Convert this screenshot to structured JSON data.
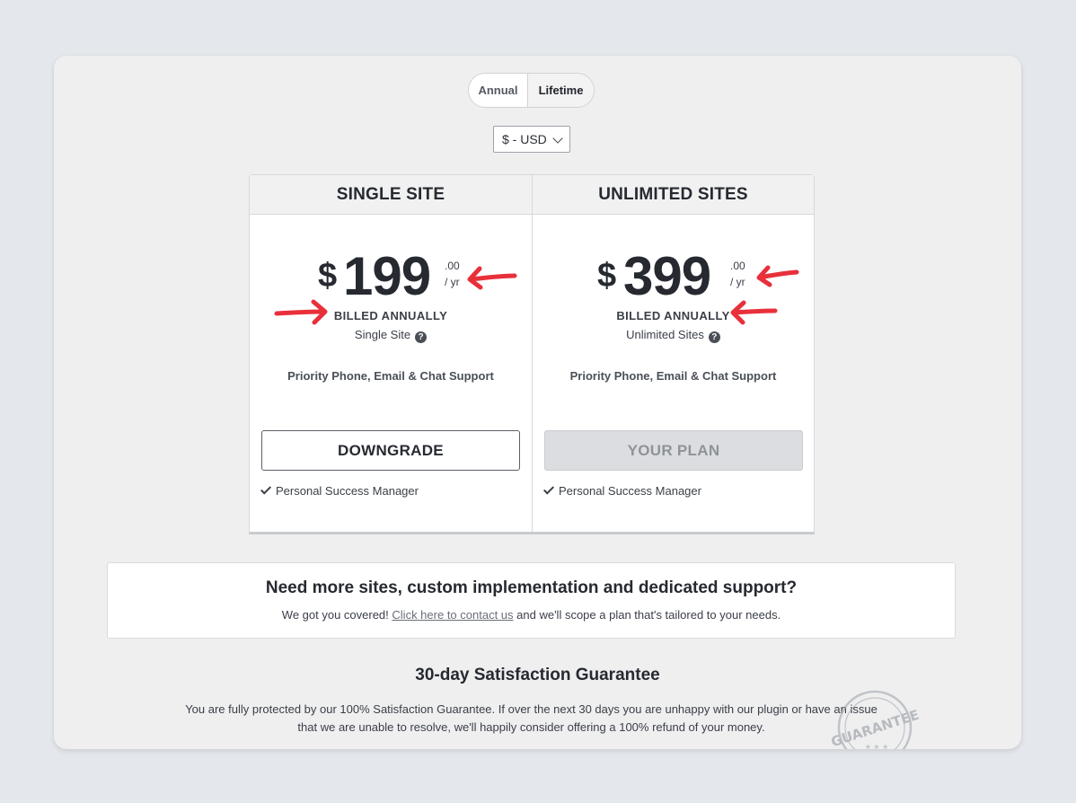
{
  "billing_toggle": {
    "options": [
      "Annual",
      "Lifetime"
    ],
    "selected": "Lifetime"
  },
  "currency": {
    "selected": "$ - USD"
  },
  "plans": [
    {
      "title": "SINGLE SITE",
      "currency_symbol": "$",
      "price": "199",
      "cents": ".00",
      "period": "/ yr",
      "billing": "BILLED ANNUALLY",
      "sites": "Single Site",
      "support": "Priority Phone, Email & Chat Support",
      "button_label": "DOWNGRADE",
      "feature": "Personal Success Manager"
    },
    {
      "title": "UNLIMITED SITES",
      "currency_symbol": "$",
      "price": "399",
      "cents": ".00",
      "period": "/ yr",
      "billing": "BILLED ANNUALLY",
      "sites": "Unlimited Sites",
      "support": "Priority Phone, Email & Chat Support",
      "button_label": "YOUR PLAN",
      "feature": "Personal Success Manager"
    }
  ],
  "contact": {
    "title": "Need more sites, custom implementation and dedicated support?",
    "text_before": "We got you covered!",
    "link_text": "Click here to contact us",
    "text_after": "and we'll scope a plan that's tailored to your needs."
  },
  "guarantee": {
    "title": "30-day Satisfaction Guarantee",
    "text_line1": "You are fully protected by our 100% Satisfaction Guarantee. If over the next 30 days you are unhappy with our plugin or have an issue",
    "text_line2": "that we are unable to resolve, we'll happily consider offering a 100% refund of your money.",
    "stamp_text": "GUARANTEE"
  },
  "annotation_color": "#e8303b"
}
